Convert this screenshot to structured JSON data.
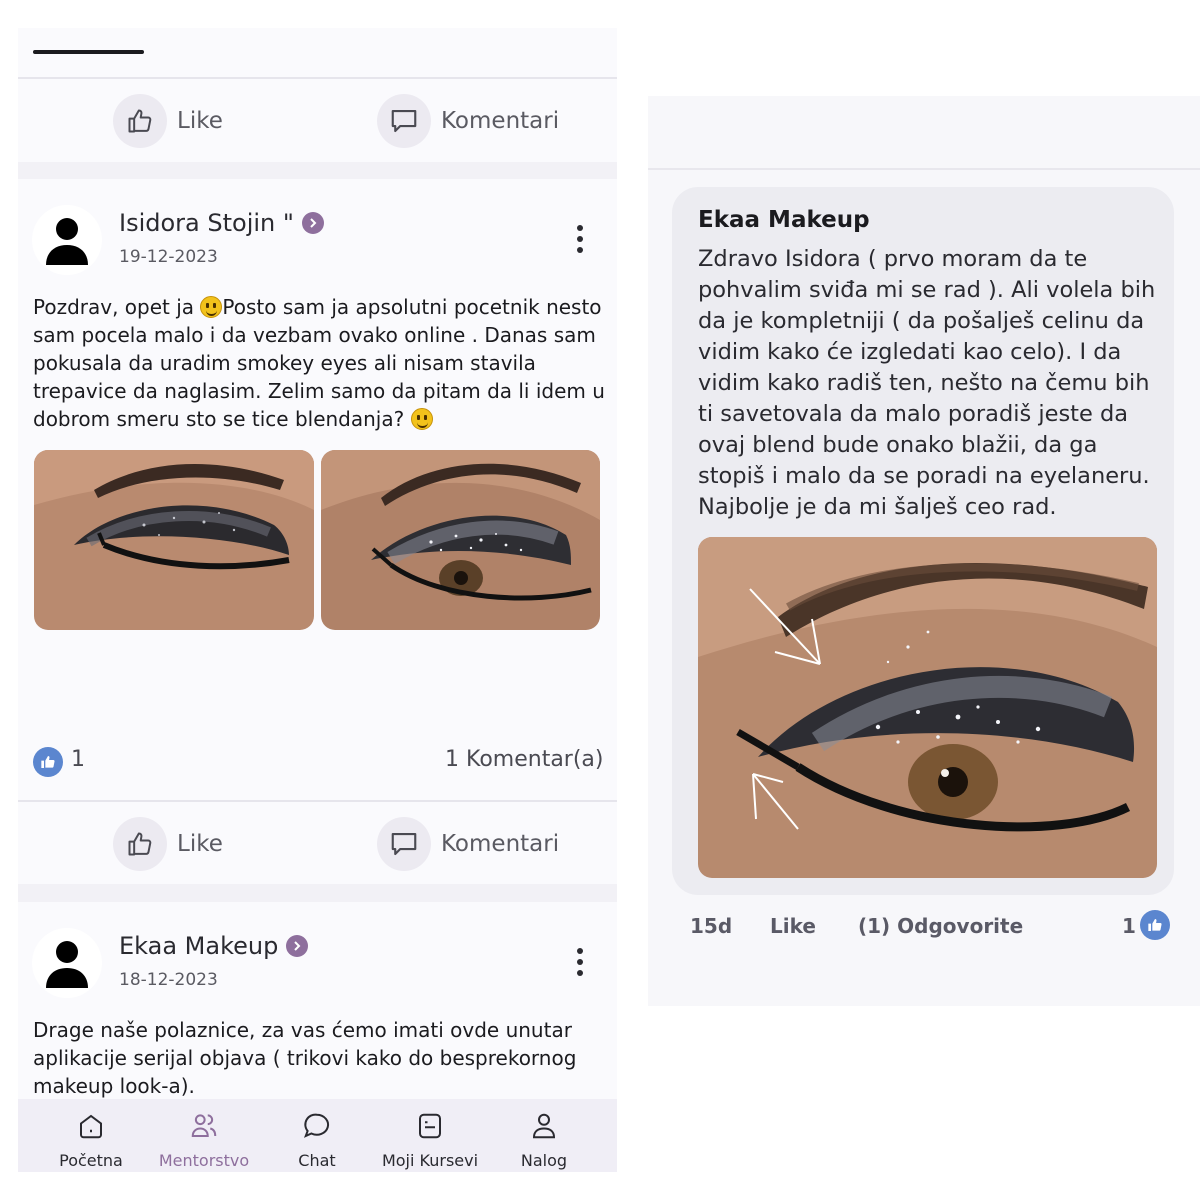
{
  "colors": {
    "accent": "#8e6f9d",
    "like_blue": "#5b86cf",
    "panel_bg": "#f2f1f6",
    "card_bg": "#fafafd",
    "bubble_bg": "#ececf1"
  },
  "top_actions": {
    "like_label": "Like",
    "comment_label": "Komentari"
  },
  "posts": [
    {
      "author": "Isidora Stojin \"",
      "date": "19-12-2023",
      "text_before_emoji": "Pozdrav, opet ja ",
      "text_middle": "Posto sam ja apsolutni pocetnik nesto sam pocela malo i da vezbam ovako online . Danas sam pokusala da uradim smokey eyes ali nisam stavila trepavice da naglasim. Zelim samo da pitam da li idem u dobrom smeru sto se tice blendanja? ",
      "likes": "1",
      "comments": "1 Komentar(a)",
      "like_label": "Like",
      "comment_label": "Komentari"
    },
    {
      "author": "Ekaa Makeup",
      "date": "18-12-2023",
      "text": "Drage naše polaznice, za vas ćemo imati ovde unutar aplikacije serijal objava ( trikovi kako do besprekornog makeup look-a)."
    }
  ],
  "bottom_nav": [
    {
      "label": "Početna",
      "icon": "home-icon",
      "active": false
    },
    {
      "label": "Mentorstvo",
      "icon": "people-icon",
      "active": true
    },
    {
      "label": "Chat",
      "icon": "chat-icon",
      "active": false
    },
    {
      "label": "Moji Kursevi",
      "icon": "courses-icon",
      "active": false
    },
    {
      "label": "Nalog",
      "icon": "user-icon",
      "active": false
    }
  ],
  "comment": {
    "author": "Ekaa Makeup",
    "text": "Zdravo Isidora ( prvo moram da te pohvalim sviđa mi se rad ). Ali volela bih da je kompletniji ( da pošalješ celinu da vidim kako će izgledati kao celo). I da vidim kako radiš ten, nešto na čemu bih ti savetovala da malo poradiš jeste da ovaj blend bude onako blažii, da ga stopiš i malo da se poradi na eyelaneru. Najbolje je da mi šalješ ceo rad.",
    "age": "15d",
    "like_label": "Like",
    "reply_label": "(1) Odgovorite",
    "likes": "1"
  }
}
